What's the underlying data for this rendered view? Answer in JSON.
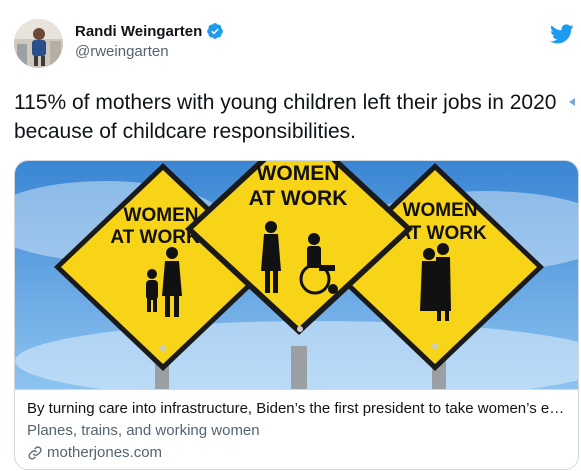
{
  "author": {
    "display_name": "Randi Weingarten",
    "handle": "@rweingarten",
    "verified": true,
    "avatar_icon": "profile-photo"
  },
  "tweet": {
    "text": "115% of mothers with young children left their jobs in 2020 because of childcare responsibilities."
  },
  "link_card": {
    "image_signs": [
      {
        "line1": "WOMEN",
        "line2": "AT WORK"
      },
      {
        "line1": "WOMEN",
        "line2": "AT WORK"
      },
      {
        "line1": "WOMEN",
        "line2": "AT WORK"
      }
    ],
    "title": "By turning care into infrastructure, Biden’s the first president to take women’s economic security seriously",
    "description": "Planes, trains, and working women",
    "domain": "motherjones.com"
  },
  "colors": {
    "twitter_blue": "#1d9bf0",
    "sign_yellow": "#f7d417",
    "sky_blue": "#3f8fd6",
    "secondary_text": "#536471"
  }
}
